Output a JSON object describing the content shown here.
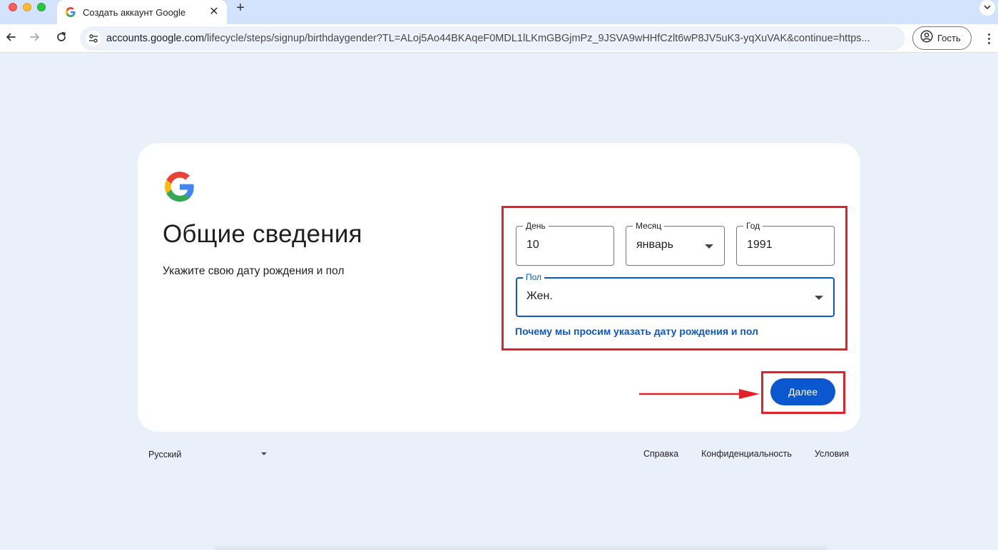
{
  "browser": {
    "tab_title": "Создать аккаунт Google",
    "url_host": "accounts.google.com",
    "url_path": "/lifecycle/steps/signup/birthdaygender?TL=ALoj5Ao44BKAqeF0MDL1lLKmGBGjmPz_9JSVA9wHHfCzlt6wP8JV5uK3-yqXuVAK&continue=https...",
    "profile_label": "Гость",
    "new_tab_symbol": "+",
    "close_symbol": "✕"
  },
  "card": {
    "heading": "Общие сведения",
    "subheading": "Укажите свою дату рождения и пол",
    "day": {
      "label": "День",
      "value": "10"
    },
    "month": {
      "label": "Месяц",
      "value": "январь"
    },
    "year": {
      "label": "Год",
      "value": "1991"
    },
    "gender": {
      "label": "Пол",
      "value": "Жен."
    },
    "why_link": "Почему мы просим указать дату рождения и пол",
    "next_button": "Далее"
  },
  "footer": {
    "language": "Русский",
    "links": [
      "Справка",
      "Конфиденциальность",
      "Условия"
    ]
  },
  "colors": {
    "accent": "#0b57d0",
    "annotation": "#e0232b",
    "page_bg": "#eaf0f9"
  },
  "icons": {
    "favicon": "google-g-icon",
    "back": "arrow-left-icon",
    "forward": "arrow-right-icon",
    "reload": "reload-icon",
    "site_info": "tune-icon",
    "profile": "account-circle-icon",
    "menu": "kebab-menu-icon"
  }
}
